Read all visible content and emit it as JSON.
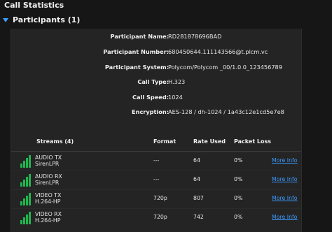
{
  "title": "Call Statistics",
  "participants_header": "Participants (1)",
  "info": [
    {
      "label": "Participant Name:",
      "value": "RD281878696BAD"
    },
    {
      "label": "Participant Number:",
      "value": "680450644.111143566@t.plcm.vc"
    },
    {
      "label": "Participant System:",
      "value": "Polycom/Polycom _00/1.0.0_123456789"
    },
    {
      "label": "Call Type:",
      "value": "H.323"
    },
    {
      "label": "Call Speed:",
      "value": "1024"
    },
    {
      "label": "Encryption:",
      "value": "AES-128 / dh-1024 / 1a43c12e1cd5e7e8"
    }
  ],
  "streams": {
    "headers": {
      "streams": "Streams (4)",
      "format": "Format",
      "rate": "Rate Used",
      "loss": "Packet Loss"
    },
    "rows": [
      {
        "name": "AUDIO TX",
        "codec": "SirenLPR",
        "format": "---",
        "rate": "64",
        "loss": "0%",
        "link": "More Info",
        "signal_level": 4
      },
      {
        "name": "AUDIO RX",
        "codec": "SirenLPR",
        "format": "---",
        "rate": "64",
        "loss": "0%",
        "link": "More Info",
        "signal_level": 4
      },
      {
        "name": "VIDEO TX",
        "codec": "H.264-HP",
        "format": "720p",
        "rate": "807",
        "loss": "0%",
        "link": "More Info",
        "signal_level": 4
      },
      {
        "name": "VIDEO RX",
        "codec": "H.264-HP",
        "format": "720p",
        "rate": "742",
        "loss": "0%",
        "link": "More Info",
        "signal_level": 4
      }
    ]
  },
  "colors": {
    "accent": "#3a9bff",
    "signal": "#1fb64f",
    "panel": "#242424",
    "background": "#161616"
  }
}
